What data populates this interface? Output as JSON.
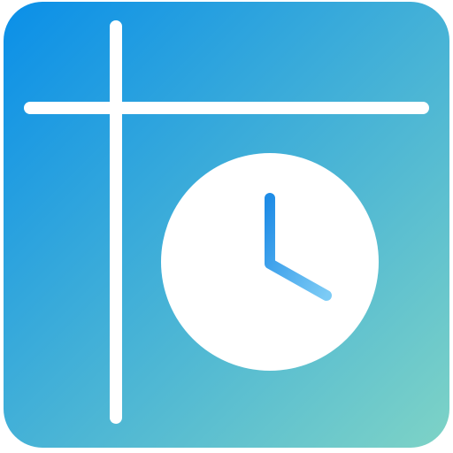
{
  "app_icon": {
    "icon_name": "timesheet-grid-clock-icon",
    "colors": {
      "gradient_start": "#0A8FE8",
      "gradient_end": "#7ED3C6",
      "lines": "#FFFFFF",
      "clock_face": "#FFFFFF",
      "clock_hands_start": "#1F8CE6",
      "clock_hands_end": "#7CCBF5"
    },
    "parts": {
      "grid_lines_icon": "cross-lines-icon",
      "clock_icon": "clock-icon"
    }
  }
}
